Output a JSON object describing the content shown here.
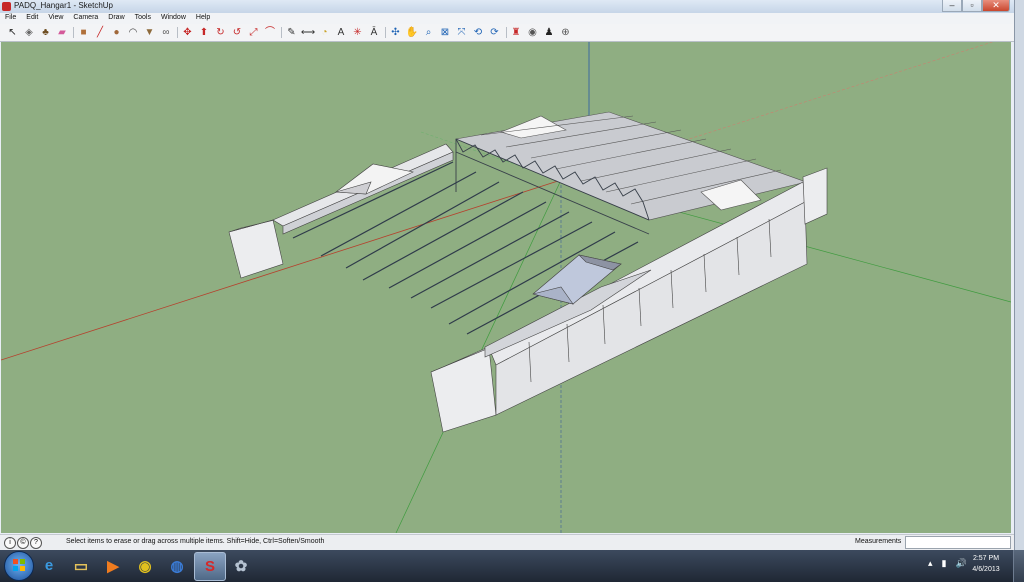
{
  "window": {
    "title": "PADQ_Hangar1 - SketchUp",
    "controls": {
      "minimize": "–",
      "maximize": "▫",
      "close": "✕"
    }
  },
  "menubar": [
    "File",
    "Edit",
    "View",
    "Camera",
    "Draw",
    "Tools",
    "Window",
    "Help"
  ],
  "toolbar": [
    {
      "name": "select-tool-icon",
      "glyph": "↖",
      "color": "#222"
    },
    {
      "name": "make-component-icon",
      "glyph": "◈",
      "color": "#666"
    },
    {
      "name": "paint-bucket-icon",
      "glyph": "♣",
      "color": "#6d4c1f"
    },
    {
      "name": "eraser-icon",
      "glyph": "▰",
      "color": "#d45a9a"
    },
    {
      "name": "rectangle-tool-icon",
      "glyph": "■",
      "color": "#b0703a"
    },
    {
      "name": "line-tool-icon",
      "glyph": "╱",
      "color": "#c62828"
    },
    {
      "name": "circle-tool-icon",
      "glyph": "●",
      "color": "#a0683a"
    },
    {
      "name": "arc-tool-icon",
      "glyph": "◠",
      "color": "#444"
    },
    {
      "name": "polygon-tool-icon",
      "glyph": "▼",
      "color": "#8d6a3b"
    },
    {
      "name": "freehand-tool-icon",
      "glyph": "∞",
      "color": "#555"
    },
    {
      "name": "move-tool-icon",
      "glyph": "✥",
      "color": "#c62828"
    },
    {
      "name": "push-pull-tool-icon",
      "glyph": "⬆",
      "color": "#c62828"
    },
    {
      "name": "rotate-tool-icon",
      "glyph": "↻",
      "color": "#c62828"
    },
    {
      "name": "follow-me-tool-icon",
      "glyph": "↺",
      "color": "#c62828"
    },
    {
      "name": "scale-tool-icon",
      "glyph": "⤢",
      "color": "#c62828"
    },
    {
      "name": "offset-tool-icon",
      "glyph": "⌒",
      "color": "#c62828"
    },
    {
      "name": "tape-measure-icon",
      "glyph": "✎",
      "color": "#333"
    },
    {
      "name": "dimension-tool-icon",
      "glyph": "⟷",
      "color": "#333"
    },
    {
      "name": "protractor-tool-icon",
      "glyph": "◔",
      "color": "#c9a227"
    },
    {
      "name": "text-tool-icon",
      "glyph": "A",
      "color": "#333"
    },
    {
      "name": "axes-tool-icon",
      "glyph": "✳",
      "color": "#c62828"
    },
    {
      "name": "3d-text-tool-icon",
      "glyph": "Ā",
      "color": "#333"
    },
    {
      "name": "orbit-tool-icon",
      "glyph": "✣",
      "color": "#1e63b5"
    },
    {
      "name": "pan-tool-icon",
      "glyph": "✋",
      "color": "#555"
    },
    {
      "name": "zoom-tool-icon",
      "glyph": "⌕",
      "color": "#1e63b5"
    },
    {
      "name": "zoom-window-icon",
      "glyph": "⊠",
      "color": "#1e63b5"
    },
    {
      "name": "zoom-extents-icon",
      "glyph": "⤧",
      "color": "#1e63b5"
    },
    {
      "name": "previous-view-icon",
      "glyph": "⟲",
      "color": "#1e63b5"
    },
    {
      "name": "next-view-icon",
      "glyph": "⟳",
      "color": "#1e63b5"
    },
    {
      "name": "position-camera-icon",
      "glyph": "♜",
      "color": "#c62828"
    },
    {
      "name": "look-around-icon",
      "glyph": "◉",
      "color": "#555"
    },
    {
      "name": "walk-tool-icon",
      "glyph": "♟",
      "color": "#222"
    },
    {
      "name": "section-plane-icon",
      "glyph": "⊕",
      "color": "#555"
    }
  ],
  "statusbar": {
    "icons": [
      {
        "name": "geo-location-icon",
        "glyph": "i"
      },
      {
        "name": "credits-icon",
        "glyph": "©"
      },
      {
        "name": "user-icon",
        "glyph": "?"
      }
    ],
    "text": "Select items to erase or drag across multiple items. Shift=Hide, Ctrl=Soften/Smooth",
    "measurements_label": "Measurements",
    "measurements_value": ""
  },
  "colors": {
    "viewport_bg": "#8fae82",
    "red_axis": "#b5412d",
    "green_axis": "#3f9b3f",
    "blue_axis": "#2a59a8"
  },
  "taskbar": {
    "apps": [
      {
        "name": "internet-explorer-icon",
        "glyph": "e",
        "color": "#3a9ae0"
      },
      {
        "name": "windows-explorer-icon",
        "glyph": "▭",
        "color": "#e3c15a"
      },
      {
        "name": "media-player-icon",
        "glyph": "▶",
        "color": "#f07c1f"
      },
      {
        "name": "chrome-icon",
        "glyph": "◉",
        "color": "#e0c01f"
      },
      {
        "name": "google-earth-icon",
        "glyph": "◍",
        "color": "#3a7bd5"
      },
      {
        "name": "sketchup-icon",
        "glyph": "S",
        "color": "#d62828"
      },
      {
        "name": "unknown-app-icon",
        "glyph": "✿",
        "color": "#b5c2d1"
      }
    ],
    "tray": {
      "arrow": "▴",
      "network": "▮",
      "volume": "🔊"
    },
    "clock": {
      "time": "2:57 PM",
      "date": "4/6/2013"
    }
  }
}
